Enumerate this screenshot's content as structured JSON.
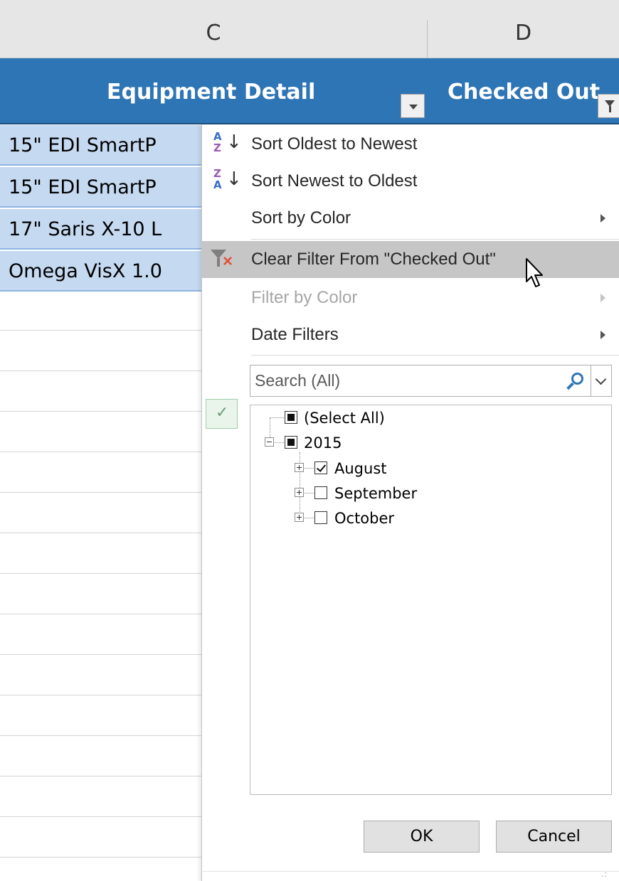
{
  "columns": {
    "c": "C",
    "d": "D"
  },
  "table_header": {
    "equipment_detail": "Equipment Detail",
    "checked_out": "Checked Out"
  },
  "rows": [
    "15\" EDI SmartP",
    "15\" EDI SmartP",
    "17\" Saris X-10 L",
    "Omega VisX 1.0"
  ],
  "menu": {
    "sort_oldest": "Sort Oldest to Newest",
    "sort_newest": "Sort Newest to Oldest",
    "sort_color": "Sort by Color",
    "clear_filter": "Clear Filter From \"Checked Out\"",
    "filter_color": "Filter by Color",
    "date_filters": "Date Filters"
  },
  "search": {
    "placeholder": "Search (All)"
  },
  "tree": {
    "select_all": "(Select All)",
    "year": "2015",
    "months": [
      {
        "label": "August",
        "checked": true
      },
      {
        "label": "September",
        "checked": false
      },
      {
        "label": "October",
        "checked": false
      }
    ]
  },
  "buttons": {
    "ok": "OK",
    "cancel": "Cancel"
  },
  "colors": {
    "header_blue": "#2e75b6",
    "row_blue": "#c5d9f1",
    "hover_gray": "#c6c6c6",
    "clear_x_red": "#e0533a"
  }
}
